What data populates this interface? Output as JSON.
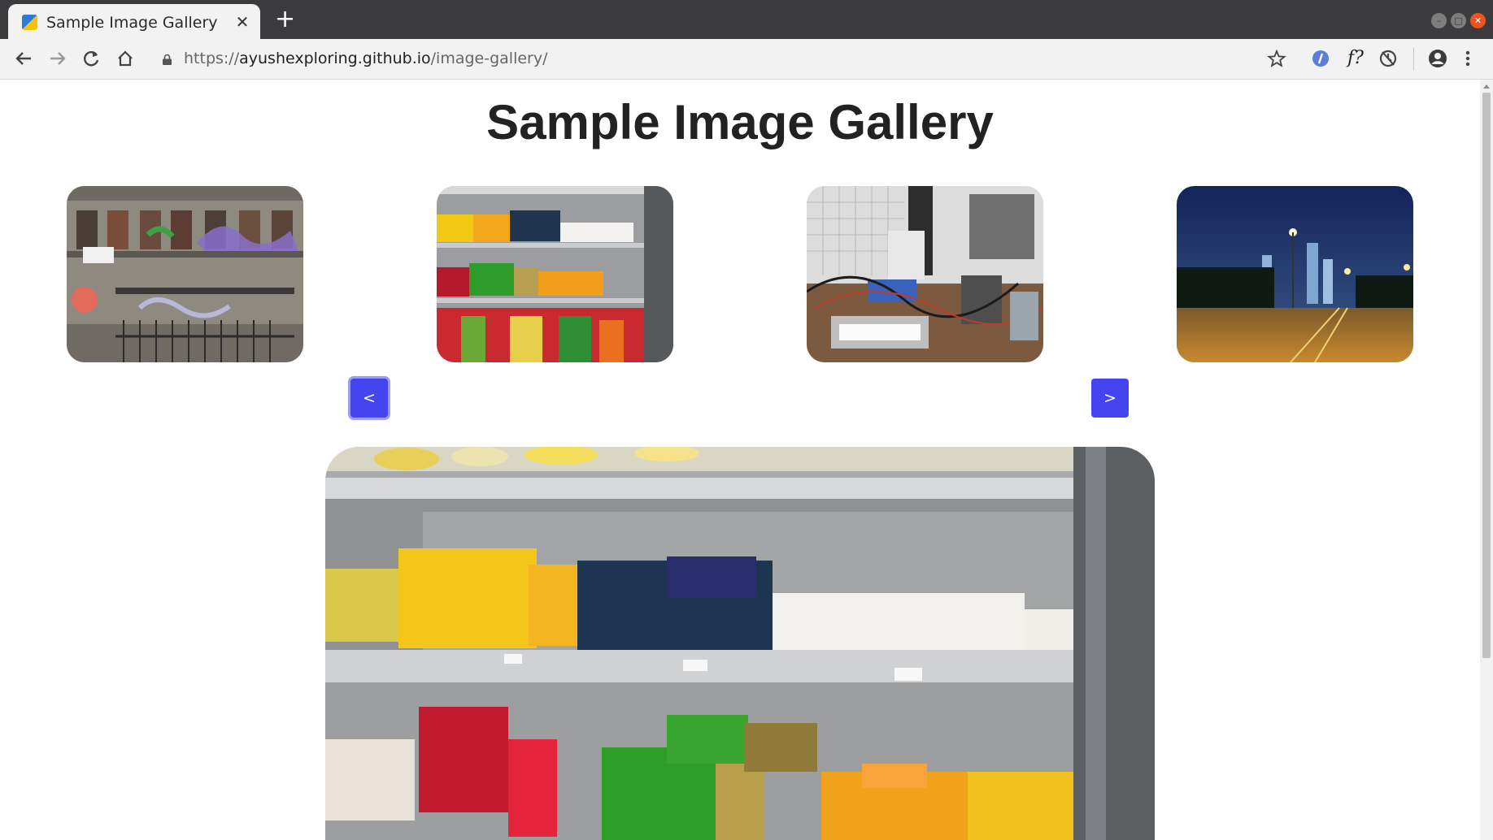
{
  "browser": {
    "tab_title": "Sample Image Gallery",
    "tab_close": "✕",
    "new_tab": "+",
    "url_scheme": "https://",
    "url_host": "ayushexploring.github.io",
    "url_path": "/image-gallery/",
    "extension_f_label": "f?"
  },
  "page": {
    "title": "Sample Image Gallery"
  },
  "gallery": {
    "prev_label": "<",
    "next_label": ">",
    "thumbnails": [
      "graffiti-building",
      "cheese-shelves",
      "electronics-workbench",
      "city-street-night"
    ],
    "selected": "cheese-shelves"
  },
  "colors": {
    "button_bg": "#4545f0",
    "button_focus": "#9a9cf5"
  }
}
